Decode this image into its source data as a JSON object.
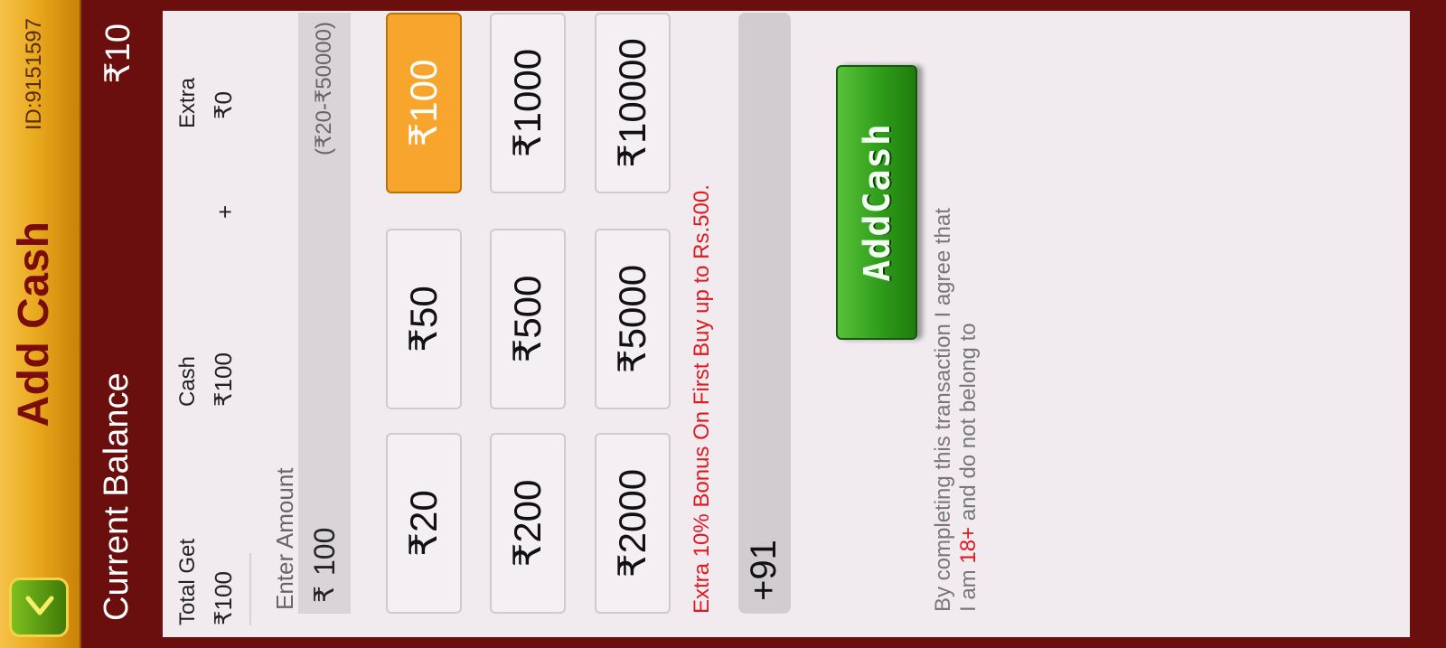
{
  "header": {
    "title": "Add Cash",
    "player_id": "ID:9151597"
  },
  "balance": {
    "label": "Current Balance",
    "value": "₹10"
  },
  "summary": {
    "total_label": "Total Get",
    "total_value": "₹100",
    "cash_label": "Cash",
    "cash_value": "₹100",
    "plus": "+",
    "extra_label": "Extra",
    "extra_value": "₹0"
  },
  "amount": {
    "label": "Enter Amount",
    "currency": "₹",
    "value": "100",
    "range": "(₹20-₹50000)"
  },
  "chips": {
    "c20": "₹20",
    "c50": "₹50",
    "c100": "₹100",
    "c200": "₹200",
    "c500": "₹500",
    "c1000": "₹1000",
    "c2000": "₹2000",
    "c5000": "₹5000",
    "c10000": "₹10000",
    "selected": "₹100"
  },
  "bonus_text": "Extra 10% Bonus On First Buy up to Rs.500.",
  "phone": {
    "code": "+91",
    "value": ""
  },
  "add_cash_button": "AddCash",
  "terms": {
    "line1": "By completing this transaction I agree that",
    "line2_prefix": "I am ",
    "age": "18+",
    "line2_suffix": " and do not belong to"
  },
  "colors": {
    "maroon": "#6a0e0e",
    "gold": "#e9a91e",
    "selected_chip": "#f7a52c",
    "bonus_red": "#e0191f",
    "button_green": "#2f9c1a"
  }
}
